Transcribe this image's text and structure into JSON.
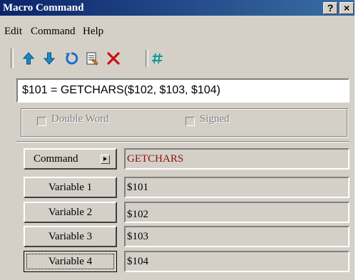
{
  "window": {
    "title": "Macro Command",
    "help_button": "?",
    "close_button": "×"
  },
  "menu": [
    "Edit",
    "Command",
    "Help"
  ],
  "toolbar": {
    "icons": [
      "move-up-icon",
      "move-down-icon",
      "undo-icon",
      "notes-icon",
      "delete-icon",
      "comment-icon"
    ],
    "colors": {
      "up": "#1a8ac9",
      "down": "#1a8ac9",
      "undo": "#1a6fc9",
      "delete": "#cc1111",
      "comment": "#119999"
    }
  },
  "formula": "$101 = GETCHARS($102, $103, $104)",
  "options": {
    "double_word": "Double Word",
    "signed": "Signed"
  },
  "command": {
    "label": "Command",
    "value": "GETCHARS"
  },
  "variables": [
    {
      "label": "Variable 1",
      "value": "$101"
    },
    {
      "label": "Variable 2",
      "value": "$102"
    },
    {
      "label": "Variable 3",
      "value": "$103"
    },
    {
      "label": "Variable 4",
      "value": "$104"
    }
  ]
}
